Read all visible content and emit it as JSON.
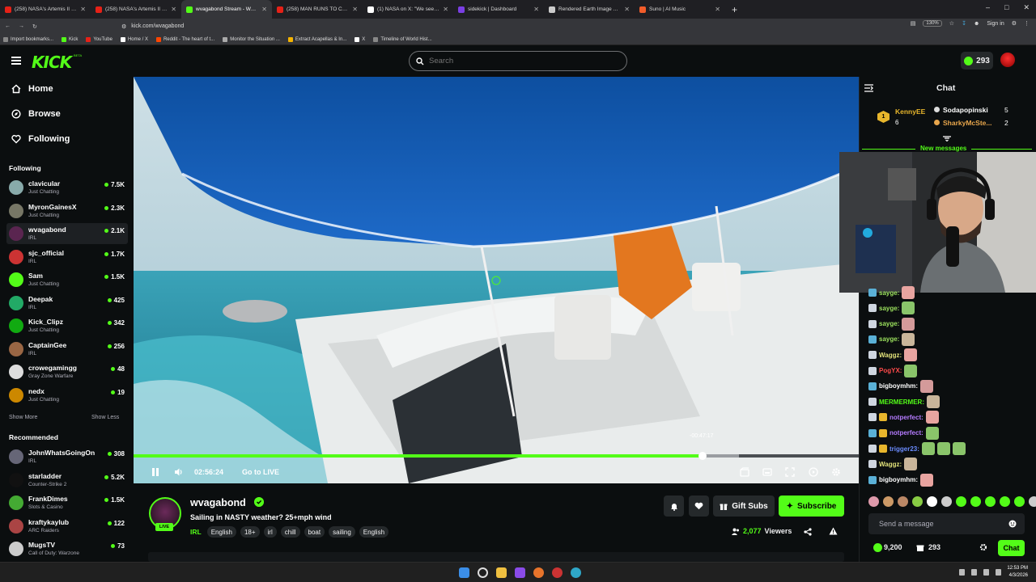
{
  "browser": {
    "tabs": [
      {
        "title": "(258) NASA's Artemis II Live Mi",
        "fav": "#e62117"
      },
      {
        "title": "(258) NASA's Artemis II Live Mi",
        "fav": "#e62117"
      },
      {
        "title": "wvagabond Stream - Watch",
        "fav": "#53fc18",
        "active": true
      },
      {
        "title": "(258) MAN RUNS TO CATCH UP",
        "fav": "#e62117"
      },
      {
        "title": "(1) NASA on X: \"We see our ho",
        "fav": "#ffffff"
      },
      {
        "title": "sidekick | Dashboard",
        "fav": "#7b3fe4"
      },
      {
        "title": "Rendered Earth Image Analysis",
        "fav": "#cccccc"
      },
      {
        "title": "Suno | AI Music",
        "fav": "#f25c2a"
      }
    ],
    "new_tab": "+",
    "url": "kick.com/wvagabond",
    "zoom": "130%",
    "signin": "Sign in",
    "bookmarks": [
      {
        "label": "Import bookmarks...",
        "color": "#888"
      },
      {
        "label": "Kick",
        "color": "#53fc18"
      },
      {
        "label": "YouTube",
        "color": "#e62117"
      },
      {
        "label": "Home / X",
        "color": "#fff"
      },
      {
        "label": "Reddit - The heart of t...",
        "color": "#ff4500"
      },
      {
        "label": "Monitor the Situation ...",
        "color": "#aaa"
      },
      {
        "label": "Extract Acapellas & In...",
        "color": "#f5b400"
      },
      {
        "label": "X",
        "color": "#fff"
      },
      {
        "label": "Timeline of World Hist...",
        "color": "#888"
      }
    ]
  },
  "header": {
    "logo": "KICK",
    "logo_badge": "BETA",
    "search_placeholder": "Search",
    "kicks_count": "293"
  },
  "sidebar": {
    "nav": [
      {
        "label": "Home",
        "icon": "home-icon"
      },
      {
        "label": "Browse",
        "icon": "compass-icon"
      },
      {
        "label": "Following",
        "icon": "heart-icon"
      }
    ],
    "following_title": "Following",
    "following": [
      {
        "name": "clavicular",
        "category": "Just Chatting",
        "viewers": "7.5K",
        "color": "#8aa"
      },
      {
        "name": "MyronGainesX",
        "category": "Just Chatting",
        "viewers": "2.3K",
        "color": "#776"
      },
      {
        "name": "wvagabond",
        "category": "IRL",
        "viewers": "2.1K",
        "color": "#5a2550",
        "selected": true
      },
      {
        "name": "sjc_official",
        "category": "IRL",
        "viewers": "1.7K",
        "color": "#c33"
      },
      {
        "name": "Sam",
        "category": "Just Chatting",
        "viewers": "1.5K",
        "color": "#53fc18"
      },
      {
        "name": "Deepak",
        "category": "IRL",
        "viewers": "425",
        "color": "#2a6"
      },
      {
        "name": "Kick_Clipz",
        "category": "Just Chatting",
        "viewers": "342",
        "color": "#1a1"
      },
      {
        "name": "CaptainGee",
        "category": "IRL",
        "viewers": "256",
        "color": "#964"
      },
      {
        "name": "crowegamingg",
        "category": "Gray Zone Warfare",
        "viewers": "48",
        "color": "#ddd"
      },
      {
        "name": "nedx",
        "category": "Just Chatting",
        "viewers": "19",
        "color": "#c80"
      }
    ],
    "show_more": "Show More",
    "show_less": "Show Less",
    "recommended_title": "Recommended",
    "recommended": [
      {
        "name": "JohnWhatsGoingOn",
        "category": "IRL",
        "viewers": "308",
        "color": "#667"
      },
      {
        "name": "starladder",
        "category": "Counter-Strike 2",
        "viewers": "5.2K",
        "color": "#111"
      },
      {
        "name": "FrankDimes",
        "category": "Slots & Casino",
        "viewers": "1.5K",
        "color": "#4a3"
      },
      {
        "name": "kraftykaylub",
        "category": "ARC Raiders",
        "viewers": "122",
        "color": "#a44"
      },
      {
        "name": "MugsTV",
        "category": "Call of Duty: Warzone",
        "viewers": "73",
        "color": "#ccc"
      }
    ]
  },
  "player": {
    "time_elapsed": "02:56:24",
    "go_live": "Go to LIVE",
    "time_behind": "-00:47:17",
    "progress": 0.785,
    "buffered": 0.835
  },
  "stream": {
    "streamer": "wvagabond",
    "live_badge": "LIVE",
    "title": "Sailing in NASTY weather? 25+mph wind",
    "category": "IRL",
    "tags": [
      "English",
      "18+",
      "irl",
      "chill",
      "boat",
      "sailing",
      "English"
    ],
    "gift_subs": "Gift Subs",
    "subscribe": "Subscribe",
    "viewers": "2,077",
    "viewers_label": "Viewers"
  },
  "chat": {
    "title": "Chat",
    "leaderboard": [
      {
        "rank": "1",
        "name": "KennyEE",
        "count": "6"
      },
      {
        "name": "Sodapopinski",
        "count": "5"
      },
      {
        "name": "SharkyMcSte...",
        "count": "2"
      }
    ],
    "new_messages": "New messages",
    "messages": [
      {
        "user": "sayge:",
        "color": "#9be15d"
      },
      {
        "user": "sayge:",
        "color": "#9be15d"
      },
      {
        "user": "sayge:",
        "color": "#9be15d"
      },
      {
        "user": "sayge:",
        "color": "#9be15d"
      },
      {
        "user": "Waggz:",
        "color": "#e2e27a"
      },
      {
        "user": "PogYX:",
        "color": "#ff4b4b"
      },
      {
        "user": "bigboymhm:",
        "color": "#ffffff"
      },
      {
        "user": "MERMERMER:",
        "color": "#53fc18"
      },
      {
        "user": "notperfect:",
        "color": "#b57bff"
      },
      {
        "user": "notperfect:",
        "color": "#b57bff"
      },
      {
        "user": "trigger23:",
        "color": "#6b8cff"
      },
      {
        "user": "Waggz:",
        "color": "#e2e27a"
      },
      {
        "user": "bigboymhm:",
        "color": "#ffffff"
      }
    ],
    "input_placeholder": "Send a message",
    "kicks_balance": "9,200",
    "gift_count": "293",
    "chat_button": "Chat"
  },
  "taskbar": {
    "time": "12:53 PM",
    "date": "4/3/2026"
  }
}
